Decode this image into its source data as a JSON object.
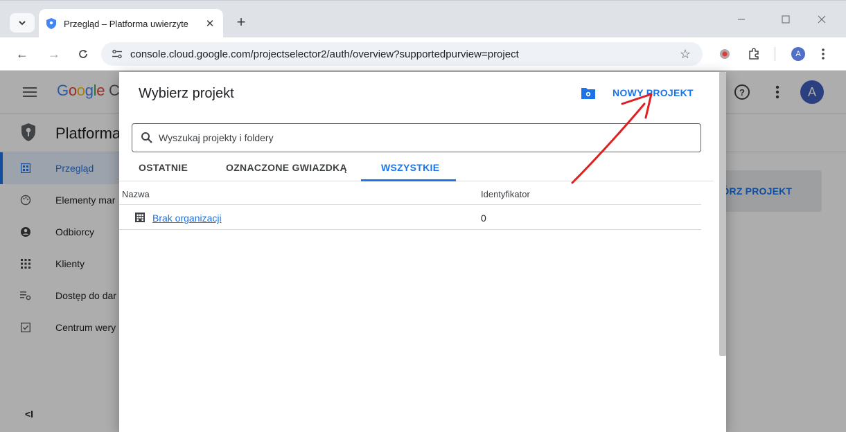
{
  "browser": {
    "tab_title": "Przegląd – Platforma uwierzyte",
    "url": "console.cloud.google.com/projectselector2/auth/overview?supportedpurview=project",
    "profile_initial": "A"
  },
  "console": {
    "logo_text": "Google C",
    "product_title": "Platforma",
    "avatar_initial": "A",
    "create_project_label": "WÓRZ PROJEKT",
    "collapse_label": "<I",
    "nav_items": [
      {
        "label": "Przegląd",
        "icon": "dashboard-icon",
        "active": true
      },
      {
        "label": "Elementy mar",
        "icon": "palette-icon",
        "active": false
      },
      {
        "label": "Odbiorcy",
        "icon": "account-circle-icon",
        "active": false
      },
      {
        "label": "Klienty",
        "icon": "apps-grid-icon",
        "active": false
      },
      {
        "label": "Dostęp do dar",
        "icon": "data-access-icon",
        "active": false
      },
      {
        "label": "Centrum wery",
        "icon": "verified-checkbox-icon",
        "active": false
      }
    ]
  },
  "dialog": {
    "title": "Wybierz projekt",
    "new_project_label": "NOWY PROJEKT",
    "search_placeholder": "Wyszukaj projekty i foldery",
    "tabs": [
      {
        "label": "OSTATNIE",
        "active": false
      },
      {
        "label": "OZNACZONE GWIAZDKĄ",
        "active": false
      },
      {
        "label": "WSZYSTKIE",
        "active": true
      }
    ],
    "columns": [
      "Nazwa",
      "Identyfikator"
    ],
    "rows": [
      {
        "name": "Brak organizacji",
        "id": "0",
        "icon": "organization-icon"
      }
    ]
  },
  "colors": {
    "accent": "#1a73e8",
    "annotation_arrow": "#e02020"
  }
}
